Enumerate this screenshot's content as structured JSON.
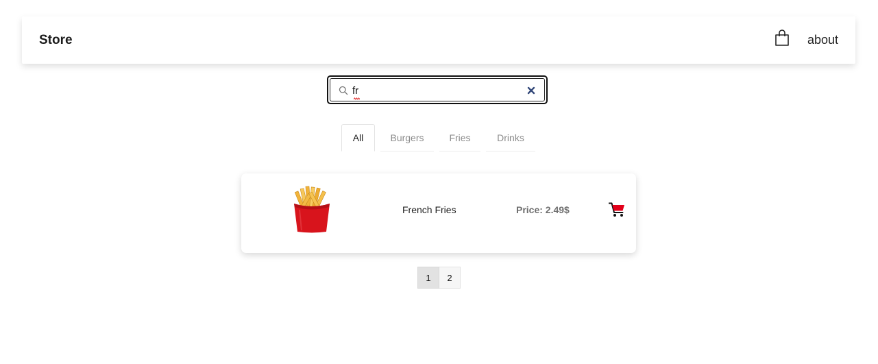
{
  "navbar": {
    "brand": "Store",
    "about_label": "about",
    "bag_icon": "shopping-bag-icon"
  },
  "search": {
    "value": "fr",
    "search_icon": "search-icon",
    "clear_icon": "close-icon"
  },
  "tabs": [
    {
      "label": "All",
      "active": true
    },
    {
      "label": "Burgers",
      "active": false
    },
    {
      "label": "Fries",
      "active": false
    },
    {
      "label": "Drinks",
      "active": false
    }
  ],
  "products": [
    {
      "name": "French Fries",
      "price": "Price: 2.49$",
      "image_icon": "french-fries-image",
      "cart_icon": "cart-icon"
    }
  ],
  "pagination": {
    "pages": [
      "1",
      "2"
    ],
    "current": "1"
  },
  "colors": {
    "cart_red": "#e2001a",
    "fries_box_red": "#d8141c",
    "clear_icon_blue": "#34497a"
  }
}
